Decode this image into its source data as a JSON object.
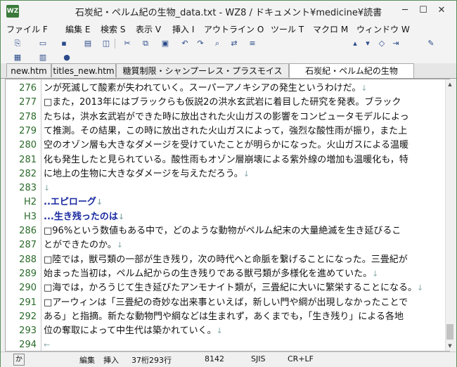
{
  "window": {
    "title": "石炭紀・ペルム紀の生物_data.txt - WZ8 / ドキュメント¥medicine¥読書",
    "app_icon": "WZ",
    "minimize": "─",
    "maximize": "☐",
    "close": "✕"
  },
  "menu": [
    "ファイル F",
    "編集 E",
    "検索 S",
    "表示 V",
    "挿入 I",
    "アウトライン O",
    "ツール T",
    "マクロ M",
    "ウィンドウ W"
  ],
  "toolbar": {
    "rating_value": "★☆☆★☆★☆☆"
  },
  "tabs": [
    {
      "label": "new.htm",
      "active": false
    },
    {
      "label": "titles_new.htm",
      "active": false
    },
    {
      "label": "糖質制限・シャンプーレス・プラスモイスト.txt",
      "active": false
    },
    {
      "label": "石炭紀・ペルム紀の生物_data.txt",
      "active": true
    }
  ],
  "lines": [
    {
      "num": "276",
      "text": "ンが死滅して酸素が失われていく。スーパーアノキシアの発生というわけだ。",
      "mark": "↓",
      "heading": false
    },
    {
      "num": "277",
      "text": "□また，2013年にはブラックらも仮説2の洪水玄武岩に着目した研究を発表。ブラック",
      "mark": "",
      "heading": false
    },
    {
      "num": "278",
      "text": "たちは，洪水玄武岩ができた時に放出された火山ガスの影響をコンピュータモデルによっ",
      "mark": "",
      "heading": false
    },
    {
      "num": "279",
      "text": "て推測。その結果，この時に放出された火山ガスによって，強烈な酸性雨が振り，また上",
      "mark": "",
      "heading": false
    },
    {
      "num": "280",
      "text": "空のオゾン層も大きなダメージを受けていたことが明らかになった。火山ガスによる温暖",
      "mark": "",
      "heading": false
    },
    {
      "num": "281",
      "text": "化も発生したと見られている。酸性雨もオゾン層崩壊による紫外線の増加も温暖化も，特",
      "mark": "",
      "heading": false
    },
    {
      "num": "282",
      "text": "に地上の生物に大きなダメージを与えただろう。",
      "mark": "↓",
      "heading": false
    },
    {
      "num": "283",
      "text": "",
      "mark": "↓",
      "heading": false
    },
    {
      "num": "H2",
      "text": "..エピローグ",
      "mark": "↓",
      "heading": true
    },
    {
      "num": "H3",
      "text": "...生き残ったのは",
      "mark": "↓",
      "heading": true
    },
    {
      "num": "286",
      "text": "□96%という数値もある中で，どのような動物がペルム紀末の大量絶滅を生き延びるこ",
      "mark": "",
      "heading": false
    },
    {
      "num": "287",
      "text": "とができたのか。",
      "mark": "↓",
      "heading": false
    },
    {
      "num": "288",
      "text": "□陸では，獣弓類の一部が生き残り，次の時代へと命脈を繋げることになった。三畳紀が",
      "mark": "",
      "heading": false
    },
    {
      "num": "289",
      "text": "始まった当初は，ペルム紀からの生き残りである獣弓類が多様化を進めていた。",
      "mark": "↓",
      "heading": false
    },
    {
      "num": "290",
      "text": "□海では，かろうじて生き延びたアンモナイト類が，三畳紀に大いに繁栄することになる。",
      "mark": "↓",
      "heading": false
    },
    {
      "num": "291",
      "text": "□アーウィンは「三畳紀の奇妙な出来事といえば，新しい門や綱が出現しなかったことで",
      "mark": "",
      "heading": false
    },
    {
      "num": "292",
      "text": "ある」と指摘。新たな動物門や綱などは生まれず，あくまでも，「生き残り」による各地",
      "mark": "",
      "heading": false
    },
    {
      "num": "293",
      "text": "位の奪取によって中生代は築かれていく。",
      "mark": "↓",
      "heading": false
    },
    {
      "num": "294",
      "text": "",
      "mark": "←",
      "heading": false
    }
  ],
  "status": {
    "ime": "か",
    "mode_edit": "編集",
    "mode_insert": "挿入",
    "position": "37桁293行",
    "size": "8142",
    "encoding": "SJIS",
    "line_ending": "CR+LF"
  }
}
